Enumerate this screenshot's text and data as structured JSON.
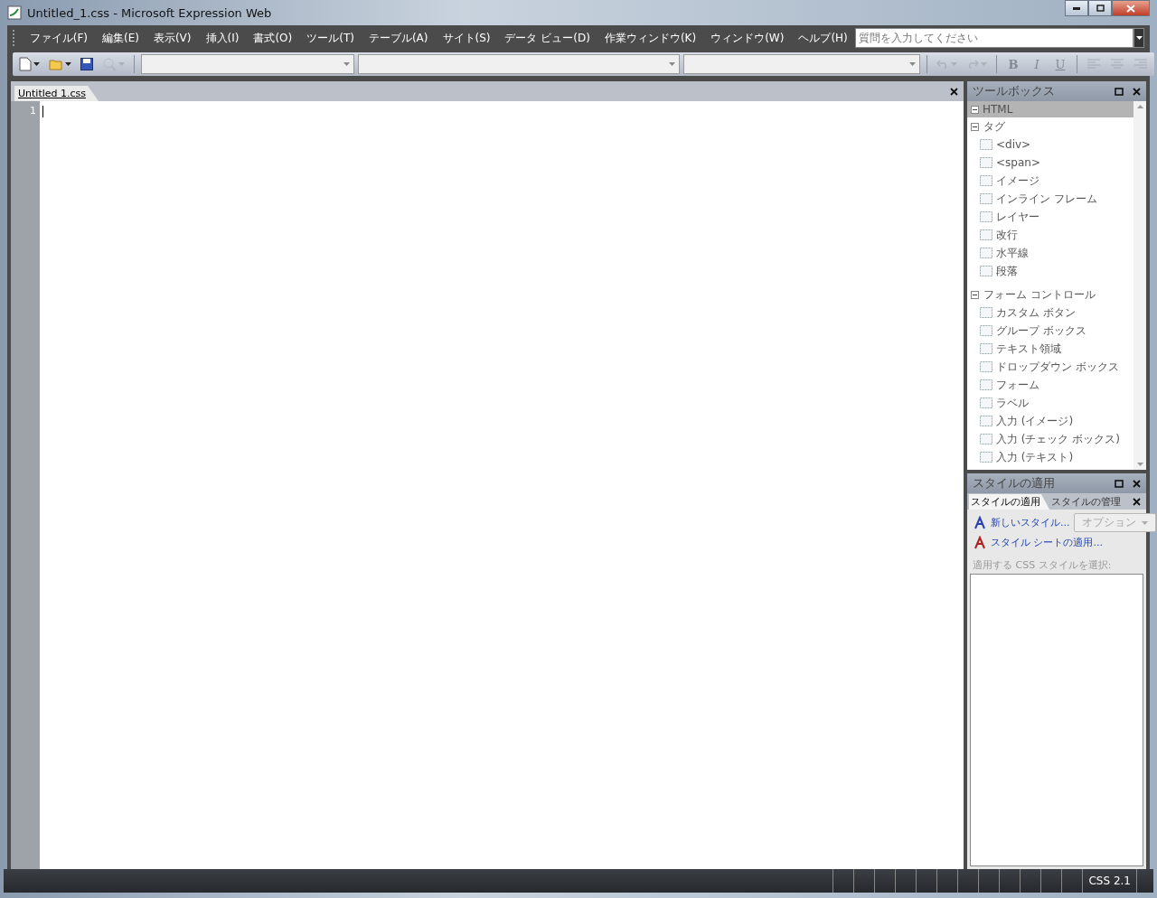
{
  "window": {
    "title": "Untitled_1.css - Microsoft Expression Web"
  },
  "menu": [
    "ファイル(F)",
    "編集(E)",
    "表示(V)",
    "挿入(I)",
    "書式(O)",
    "ツール(T)",
    "テーブル(A)",
    "サイト(S)",
    "データ ビュー(D)",
    "作業ウィンドウ(K)",
    "ウィンドウ(W)",
    "ヘルプ(H)"
  ],
  "help_search": {
    "placeholder": "質問を入力してください"
  },
  "toolbar": {
    "left": [
      {
        "kind": "new",
        "disabled": false
      },
      {
        "kind": "open",
        "disabled": false
      },
      {
        "kind": "save",
        "disabled": false
      },
      {
        "kind": "preview",
        "disabled": true
      }
    ],
    "right": [
      {
        "kind": "undo",
        "disabled": true
      },
      {
        "kind": "redo",
        "disabled": true
      },
      {
        "kind": "bold",
        "label": "B",
        "disabled": true
      },
      {
        "kind": "italic",
        "label": "I",
        "disabled": true
      },
      {
        "kind": "underline",
        "label": "U",
        "disabled": true
      },
      {
        "kind": "align-left",
        "disabled": true
      },
      {
        "kind": "align-center",
        "disabled": true
      },
      {
        "kind": "align-right",
        "disabled": true
      }
    ]
  },
  "editor": {
    "tabs": [
      {
        "label": "Untitled 1.css",
        "selected": true
      }
    ],
    "line_numbers": [
      "1"
    ]
  },
  "toolbox": {
    "title": "ツールボックス",
    "groups": [
      {
        "label": "HTML",
        "disabled": true,
        "expanded": true,
        "children": [
          {
            "label": "タグ",
            "expanded": true,
            "children": [
              {
                "label": "<div>"
              },
              {
                "label": "<span>"
              },
              {
                "label": "イメージ"
              },
              {
                "label": "インライン フレーム"
              },
              {
                "label": "レイヤー"
              },
              {
                "label": "改行"
              },
              {
                "label": "水平線"
              },
              {
                "label": "段落"
              }
            ]
          },
          {
            "label": "フォーム コントロール",
            "expanded": true,
            "children": [
              {
                "label": "カスタム ボタン"
              },
              {
                "label": "グループ ボックス"
              },
              {
                "label": "テキスト領域"
              },
              {
                "label": "ドロップダウン ボックス"
              },
              {
                "label": "フォーム"
              },
              {
                "label": "ラベル"
              },
              {
                "label": "入力 (イメージ)"
              },
              {
                "label": "入力 (チェック ボックス)"
              },
              {
                "label": "入力 (テキスト)"
              }
            ]
          }
        ]
      }
    ]
  },
  "styles_panel": {
    "title": "スタイルの適用",
    "tabs": [
      {
        "label": "スタイルの適用",
        "selected": true
      },
      {
        "label": "スタイルの管理",
        "selected": false
      }
    ],
    "links": [
      "新しいスタイル...",
      "スタイル シートの適用..."
    ],
    "options_button": {
      "label": "オプション",
      "disabled": true
    },
    "prompt": "適用する CSS スタイルを選択:"
  },
  "status_bar": {
    "schema": "CSS 2.1"
  }
}
